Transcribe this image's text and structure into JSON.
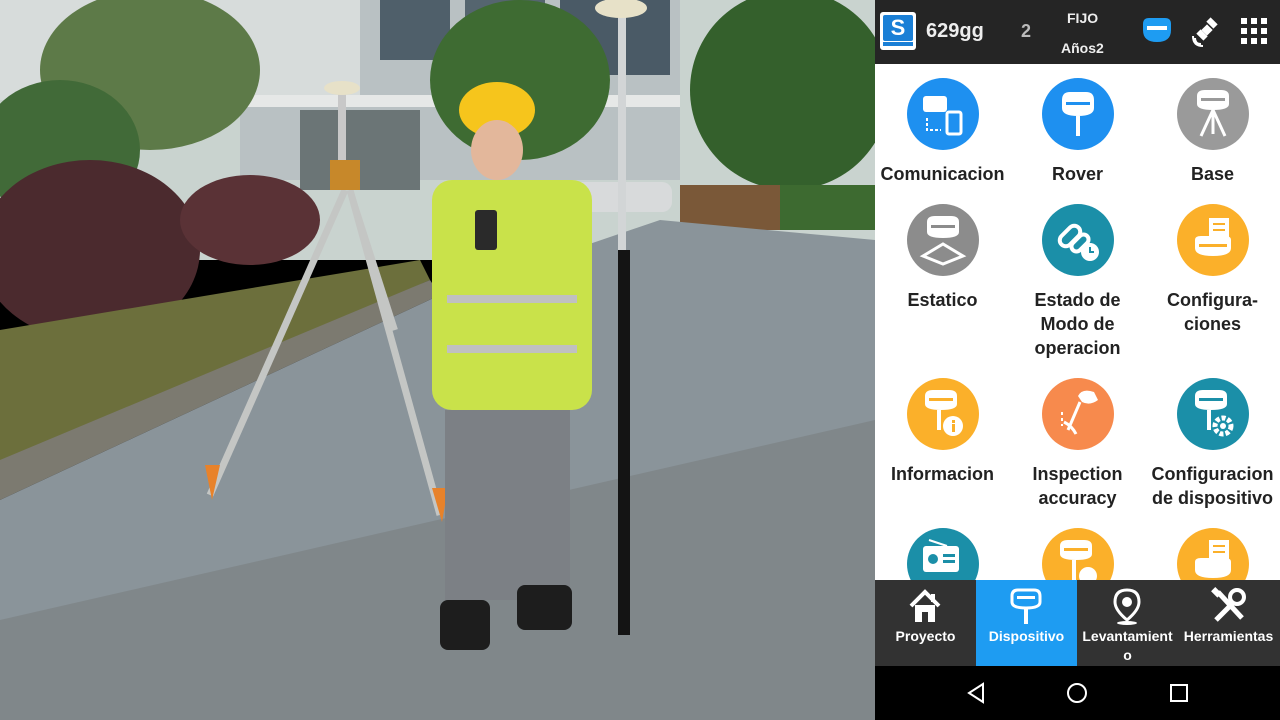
{
  "status_bar": {
    "satellites": "629gg",
    "count": "2",
    "solution": "FIJO",
    "age": "Años2",
    "icons": [
      "receiver-icon",
      "satellite-icon",
      "apps-grid-icon"
    ]
  },
  "menu": {
    "items": [
      {
        "label": "Comunicacion",
        "icon": "communication-icon",
        "color": "#1e90f0"
      },
      {
        "label": "Rover",
        "icon": "rover-icon",
        "color": "#1e90f0"
      },
      {
        "label": "Base",
        "icon": "base-icon",
        "color": "#9a9a9a"
      },
      {
        "label": "Estatico",
        "icon": "static-icon",
        "color": "#8c8c8c"
      },
      {
        "label": "Estado de Modo de operacion",
        "icon": "link-status-icon",
        "color": "#1b8fa8"
      },
      {
        "label": "Configura- ciones",
        "icon": "configuration-icon",
        "color": "#fbb02a"
      },
      {
        "label": "Informacion",
        "icon": "info-icon",
        "color": "#fbb02a"
      },
      {
        "label": "Inspection accuracy",
        "icon": "inspection-icon",
        "color": "#f78a4d"
      },
      {
        "label": "Configuracion de dispositivo",
        "icon": "device-config-icon",
        "color": "#1b8fa8"
      },
      {
        "label": "",
        "icon": "radio-settings-icon",
        "color": "#1b8fa8"
      },
      {
        "label": "",
        "icon": "receiver-time-icon",
        "color": "#fbb02a"
      },
      {
        "label": "",
        "icon": "receiver-list-icon",
        "color": "#fbb02a"
      }
    ]
  },
  "nav": {
    "items": [
      {
        "label": "Proyecto",
        "icon": "home-icon"
      },
      {
        "label": "Dispositivo",
        "icon": "device-icon",
        "active": true
      },
      {
        "label": "Levantamient o",
        "icon": "location-pin-icon"
      },
      {
        "label": "Herramientas",
        "icon": "tools-icon"
      }
    ]
  },
  "system_nav": [
    "back-icon",
    "home-circle-icon",
    "recents-icon"
  ],
  "colors": {
    "accent": "#1e9cf2",
    "topbar": "#252525",
    "bottomnav": "#323232"
  }
}
